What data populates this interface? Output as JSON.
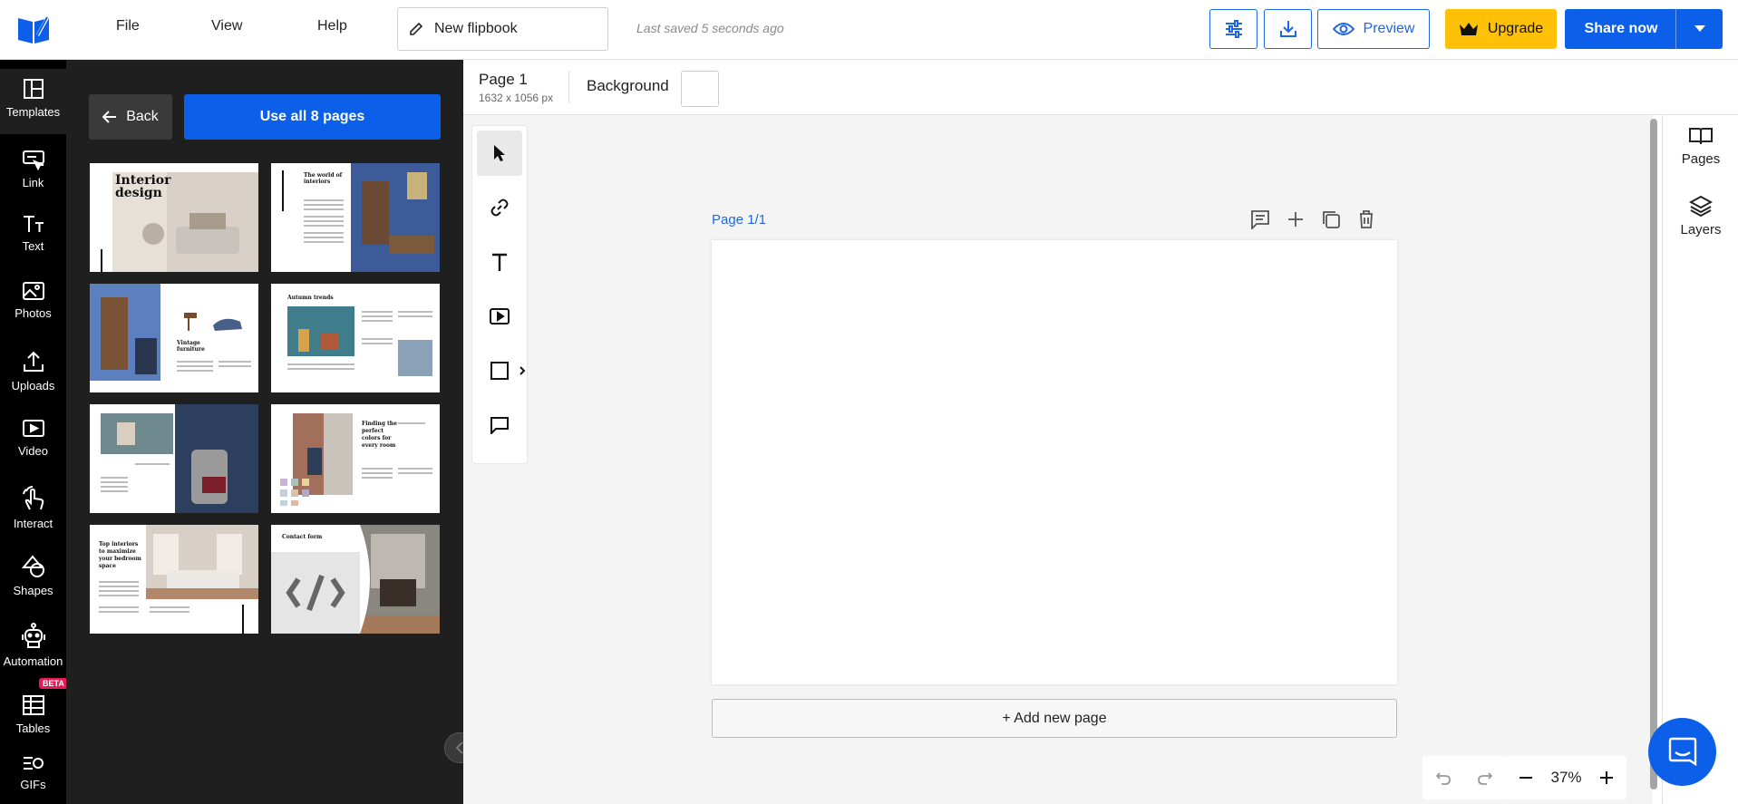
{
  "header": {
    "menu": [
      "File",
      "View",
      "Help"
    ],
    "title": "New flipbook",
    "last_saved": "Last saved 5 seconds ago",
    "preview_label": "Preview",
    "upgrade_label": "Upgrade",
    "share_label": "Share now",
    "accent_color": "#0b5fe8",
    "upgrade_color": "#ffc107"
  },
  "rail": {
    "items": [
      {
        "label": "Templates",
        "icon": "templates-icon"
      },
      {
        "label": "Link",
        "icon": "link-icon"
      },
      {
        "label": "Text",
        "icon": "text-icon"
      },
      {
        "label": "Photos",
        "icon": "photos-icon"
      },
      {
        "label": "Uploads",
        "icon": "uploads-icon"
      },
      {
        "label": "Video",
        "icon": "video-icon"
      },
      {
        "label": "Interact",
        "icon": "interact-icon"
      },
      {
        "label": "Shapes",
        "icon": "shapes-icon"
      },
      {
        "label": "Automation",
        "icon": "automation-icon"
      },
      {
        "label": "Tables",
        "icon": "tables-icon"
      },
      {
        "label": "GIFs",
        "icon": "gifs-icon"
      }
    ],
    "beta_badge": "BETA"
  },
  "templates": {
    "back_label": "Back",
    "use_all_label": "Use all 8 pages",
    "thumbnails": [
      {
        "heading": "Interior design"
      },
      {
        "heading": "The world of interiors"
      },
      {
        "heading": "Vintage furniture"
      },
      {
        "heading": "Autumn trends"
      },
      {
        "heading": ""
      },
      {
        "heading": "Finding the perfect colors for every room"
      },
      {
        "heading": "Top interiors to maximize your bedroom space"
      },
      {
        "heading": "Contact form"
      }
    ]
  },
  "page_bar": {
    "page_name": "Page 1",
    "dimensions": "1632 x 1056 px",
    "background_label": "Background"
  },
  "canvas": {
    "page_label": "Page 1/1",
    "add_page_label": "+ Add new page",
    "zoom": "37%"
  },
  "right_panel": {
    "pages_label": "Pages",
    "layers_label": "Layers"
  }
}
